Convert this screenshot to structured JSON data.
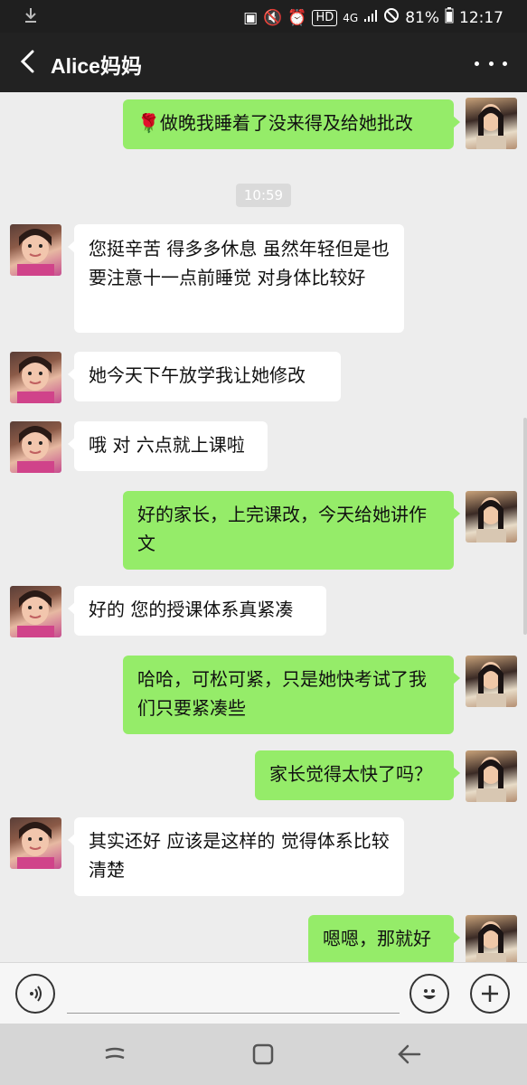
{
  "status_bar": {
    "battery": "81%",
    "time": "12:17",
    "network": "4G",
    "hd": "HD",
    "icons": [
      "download-icon",
      "battery-saver-icon",
      "mute-icon",
      "alarm-icon",
      "signal-icon",
      "no-disturb-icon",
      "battery-icon"
    ]
  },
  "header": {
    "title": "Alice妈妈",
    "icons": [
      "back-arrow-icon",
      "more-options-icon"
    ]
  },
  "timestamp": "10:59",
  "messages": [
    {
      "side": "out",
      "text": "🌹做晚我睡着了没来得及给她批改"
    },
    {
      "side": "in",
      "text": "您挺辛苦 得多多休息 虽然年轻但是也要注意十一点前睡觉 对身体比较好"
    },
    {
      "side": "in",
      "text": "她今天下午放学我让她修改"
    },
    {
      "side": "in",
      "text": "哦 对 六点就上课啦"
    },
    {
      "side": "out",
      "text": "好的家长，上完课改，今天给她讲作文"
    },
    {
      "side": "in",
      "text": "好的 您的授课体系真紧凑"
    },
    {
      "side": "out",
      "text": "哈哈，可松可紧，只是她快考试了我们只要紧凑些"
    },
    {
      "side": "out",
      "text": "家长觉得太快了吗？"
    },
    {
      "side": "in",
      "text": "其实还好 应该是这样的 觉得体系比较清楚"
    },
    {
      "side": "out",
      "text": "嗯嗯，那就好"
    }
  ],
  "input_bar": {
    "text_value": "",
    "icons": [
      "voice-icon",
      "emoji-icon",
      "plus-icon"
    ]
  },
  "nav_bar": {
    "icons": [
      "recents-icon",
      "home-icon",
      "back-nav-icon"
    ]
  },
  "colors": {
    "header_bg": "#222222",
    "chat_bg": "#ededed",
    "outgoing_bubble": "#95ec69",
    "incoming_bubble": "#ffffff"
  }
}
